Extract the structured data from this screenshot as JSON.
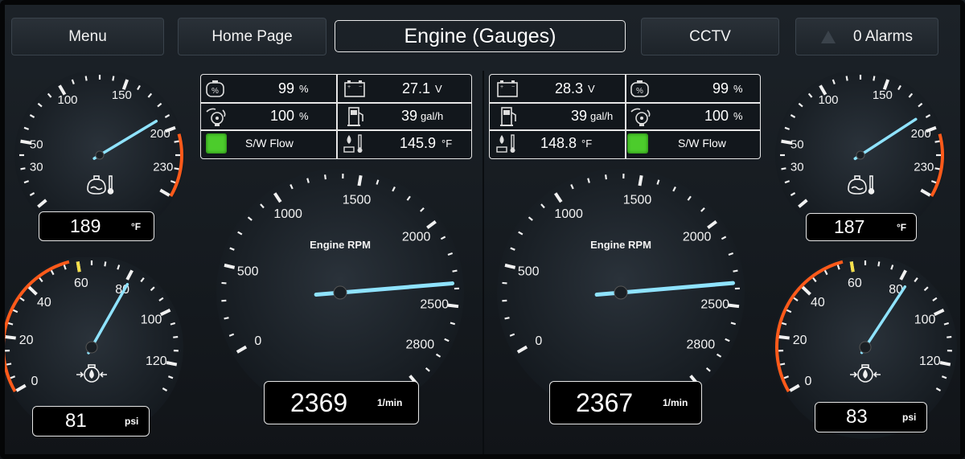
{
  "toolbar": {
    "menu_label": "Menu",
    "home_label": "Home Page",
    "title": "Engine (Gauges)",
    "cctv_label": "CCTV",
    "alarms_label": "0 Alarms"
  },
  "engines": [
    {
      "side": "port",
      "rpm": {
        "label": "Engine RPM",
        "value": "2369",
        "unit": "1/min",
        "reading": 2369,
        "max": 3000,
        "ticks": [
          "0",
          "500",
          "1000",
          "1500",
          "2000",
          "2500",
          "2800"
        ]
      },
      "coolant": {
        "value": "189",
        "unit": "°F",
        "reading": 189,
        "min": 0,
        "max": 250,
        "ticks": [
          "30",
          "50",
          "100",
          "150",
          "200",
          "230"
        ]
      },
      "oil_pressure": {
        "value": "81",
        "unit": "psi",
        "reading": 81,
        "min": 0,
        "max": 130,
        "ticks": [
          "0",
          "20",
          "40",
          "60",
          "80",
          "100",
          "120"
        ]
      },
      "panel": {
        "load": {
          "value": "99",
          "unit": "%"
        },
        "battery": {
          "value": "27.1",
          "unit": "V"
        },
        "torque": {
          "value": "100",
          "unit": "%"
        },
        "fuel_rate": {
          "value": "39",
          "unit": "gal/h"
        },
        "sw_flow": {
          "label": "S/W Flow",
          "status_color": "#4ccc2c"
        },
        "oil_temp": {
          "value": "145.9",
          "unit": "°F"
        }
      }
    },
    {
      "side": "starboard",
      "rpm": {
        "label": "Engine RPM",
        "value": "2367",
        "unit": "1/min",
        "reading": 2367,
        "max": 3000,
        "ticks": [
          "0",
          "500",
          "1000",
          "1500",
          "2000",
          "2500",
          "2800"
        ]
      },
      "coolant": {
        "value": "187",
        "unit": "°F",
        "reading": 187,
        "min": 0,
        "max": 250,
        "ticks": [
          "30",
          "50",
          "100",
          "150",
          "200",
          "230"
        ]
      },
      "oil_pressure": {
        "value": "83",
        "unit": "psi",
        "reading": 83,
        "min": 0,
        "max": 130,
        "ticks": [
          "0",
          "20",
          "40",
          "60",
          "80",
          "100",
          "120"
        ]
      },
      "panel": {
        "battery": {
          "value": "28.3",
          "unit": "V"
        },
        "load": {
          "value": "99",
          "unit": "%"
        },
        "fuel_rate": {
          "value": "39",
          "unit": "gal/h"
        },
        "torque": {
          "value": "100",
          "unit": "%"
        },
        "oil_temp": {
          "value": "148.8",
          "unit": "°F"
        },
        "sw_flow": {
          "label": "S/W Flow",
          "status_color": "#4ccc2c"
        }
      }
    }
  ],
  "colors": {
    "needle": "#8fe3ff",
    "warning_arc": "#ff5a1a",
    "caution_mark": "#f5e04a",
    "status_ok": "#4ccc2c"
  },
  "icons": {
    "load": "engine-percent-icon",
    "battery": "battery-icon",
    "torque": "torque-icon",
    "fuel_rate": "fuel-pump-icon",
    "sw_flow": "status-led-icon",
    "oil_temp": "oil-temperature-icon",
    "coolant": "coolant-temperature-icon",
    "oil_pressure": "oil-pressure-icon",
    "alarm": "warning-triangle-icon"
  }
}
